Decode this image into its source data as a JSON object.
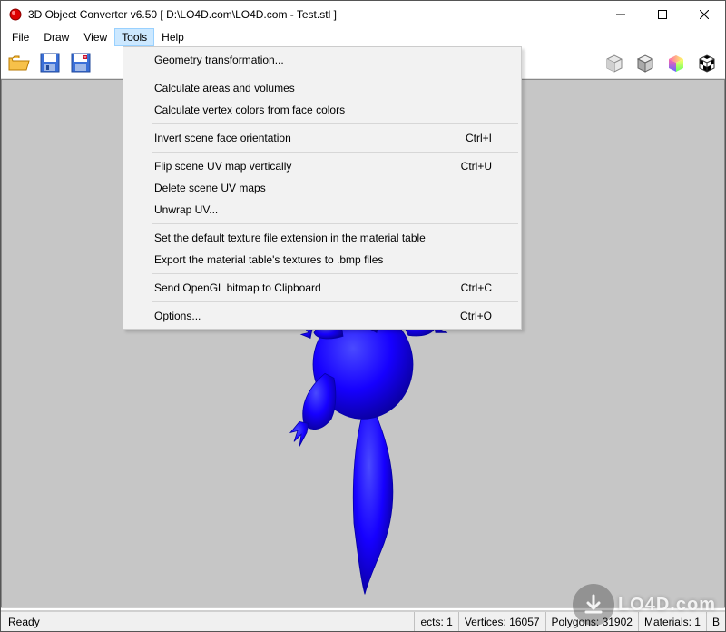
{
  "titlebar": {
    "title": "3D Object Converter v6.50     [ D:\\LO4D.com\\LO4D.com - Test.stl ]"
  },
  "menubar": {
    "items": [
      "File",
      "Draw",
      "View",
      "Tools",
      "Help"
    ],
    "active_index": 3
  },
  "toolbar": {
    "icons_left": [
      "open-icon",
      "save-icon",
      "save-as-icon"
    ],
    "icons_right": [
      "cube-icon",
      "cube-grey-icon",
      "cube-color-icon",
      "cube-checker-icon"
    ]
  },
  "dropdown": [
    {
      "type": "item",
      "label": "Geometry transformation...",
      "accel": ""
    },
    {
      "type": "sep"
    },
    {
      "type": "item",
      "label": "Calculate areas and volumes",
      "accel": ""
    },
    {
      "type": "item",
      "label": "Calculate vertex colors from face colors",
      "accel": ""
    },
    {
      "type": "sep"
    },
    {
      "type": "item",
      "label": "Invert scene face orientation",
      "accel": "Ctrl+I"
    },
    {
      "type": "sep"
    },
    {
      "type": "item",
      "label": "Flip scene UV map vertically",
      "accel": "Ctrl+U"
    },
    {
      "type": "item",
      "label": "Delete scene UV maps",
      "accel": ""
    },
    {
      "type": "item",
      "label": "Unwrap UV...",
      "accel": ""
    },
    {
      "type": "sep"
    },
    {
      "type": "item",
      "label": "Set the default texture file extension in the material table",
      "accel": ""
    },
    {
      "type": "item",
      "label": "Export the material table's textures to .bmp files",
      "accel": ""
    },
    {
      "type": "sep"
    },
    {
      "type": "item",
      "label": "Send OpenGL bitmap to Clipboard",
      "accel": "Ctrl+C"
    },
    {
      "type": "sep"
    },
    {
      "type": "item",
      "label": "Options...",
      "accel": "Ctrl+O"
    }
  ],
  "statusbar": {
    "left": "Ready",
    "segments": [
      "ects:  1",
      "Vertices:  16057",
      "Polygons:  31902",
      "Materials:  1",
      "B"
    ]
  },
  "watermark": {
    "text": "LO4D.com"
  },
  "colors": {
    "viewport_bg": "#c6c6c6",
    "model": "#1600ff",
    "menu_highlight": "#cce8ff"
  }
}
